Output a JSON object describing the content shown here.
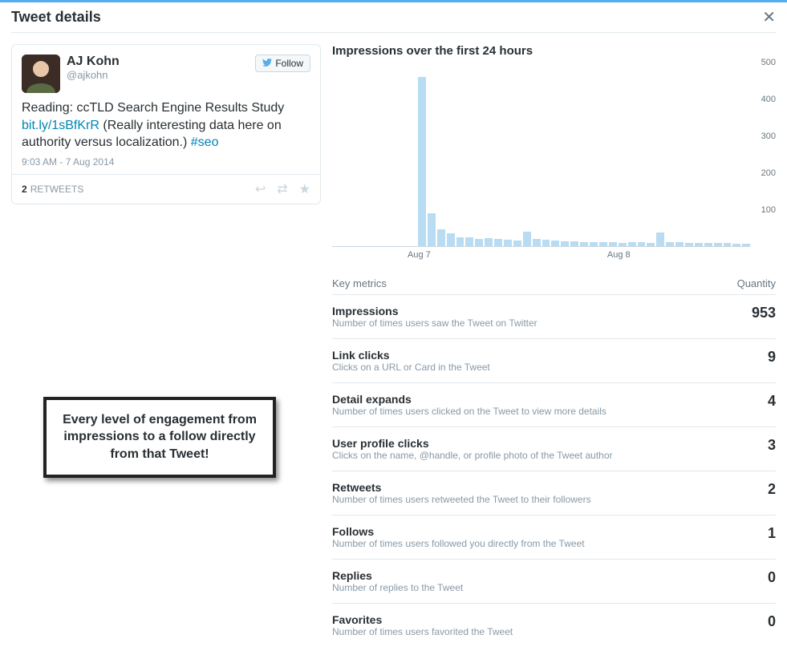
{
  "header": {
    "title": "Tweet details"
  },
  "tweet": {
    "author_name": "AJ Kohn",
    "author_handle": "@ajkohn",
    "follow_label": "Follow",
    "text_before_link": "Reading: ccTLD Search Engine Results Study ",
    "link_text": "bit.ly/1sBfKrR",
    "text_after_link": " (Really interesting data here on authority versus localization.) ",
    "hashtag": "#seo",
    "timestamp": "9:03 AM - 7 Aug 2014",
    "retweets_count": "2",
    "retweets_label": "RETWEETS"
  },
  "callout": {
    "text": "Every level of engagement from impressions to a follow directly from that Tweet!"
  },
  "chart": {
    "title": "Impressions over the first 24 hours"
  },
  "metrics_header": {
    "left": "Key metrics",
    "right": "Quantity"
  },
  "metrics": [
    {
      "name": "Impressions",
      "desc": "Number of times users saw the Tweet on Twitter",
      "value": "953"
    },
    {
      "name": "Link clicks",
      "desc": "Clicks on a URL or Card in the Tweet",
      "value": "9"
    },
    {
      "name": "Detail expands",
      "desc": "Number of times users clicked on the Tweet to view more details",
      "value": "4"
    },
    {
      "name": "User profile clicks",
      "desc": "Clicks on the name, @handle, or profile photo of the Tweet author",
      "value": "3"
    },
    {
      "name": "Retweets",
      "desc": "Number of times users retweeted the Tweet to their followers",
      "value": "2"
    },
    {
      "name": "Follows",
      "desc": "Number of times users followed you directly from the Tweet",
      "value": "1"
    },
    {
      "name": "Replies",
      "desc": "Number of replies to the Tweet",
      "value": "0"
    },
    {
      "name": "Favorites",
      "desc": "Number of times users favorited the Tweet",
      "value": "0"
    }
  ],
  "chart_data": {
    "type": "bar",
    "title": "Impressions over the first 24 hours",
    "xlabel": "",
    "ylabel": "",
    "ylim": [
      0,
      500
    ],
    "yticks": [
      100,
      200,
      300,
      400,
      500
    ],
    "xticks": [
      "Aug 7",
      "Aug 8"
    ],
    "values": [
      0,
      0,
      0,
      0,
      0,
      0,
      0,
      0,
      0,
      460,
      90,
      45,
      35,
      25,
      25,
      20,
      22,
      20,
      18,
      16,
      40,
      20,
      18,
      16,
      14,
      14,
      12,
      12,
      11,
      10,
      9,
      10,
      10,
      9,
      38,
      12,
      10,
      9,
      8,
      8,
      8,
      8,
      7,
      7
    ]
  }
}
